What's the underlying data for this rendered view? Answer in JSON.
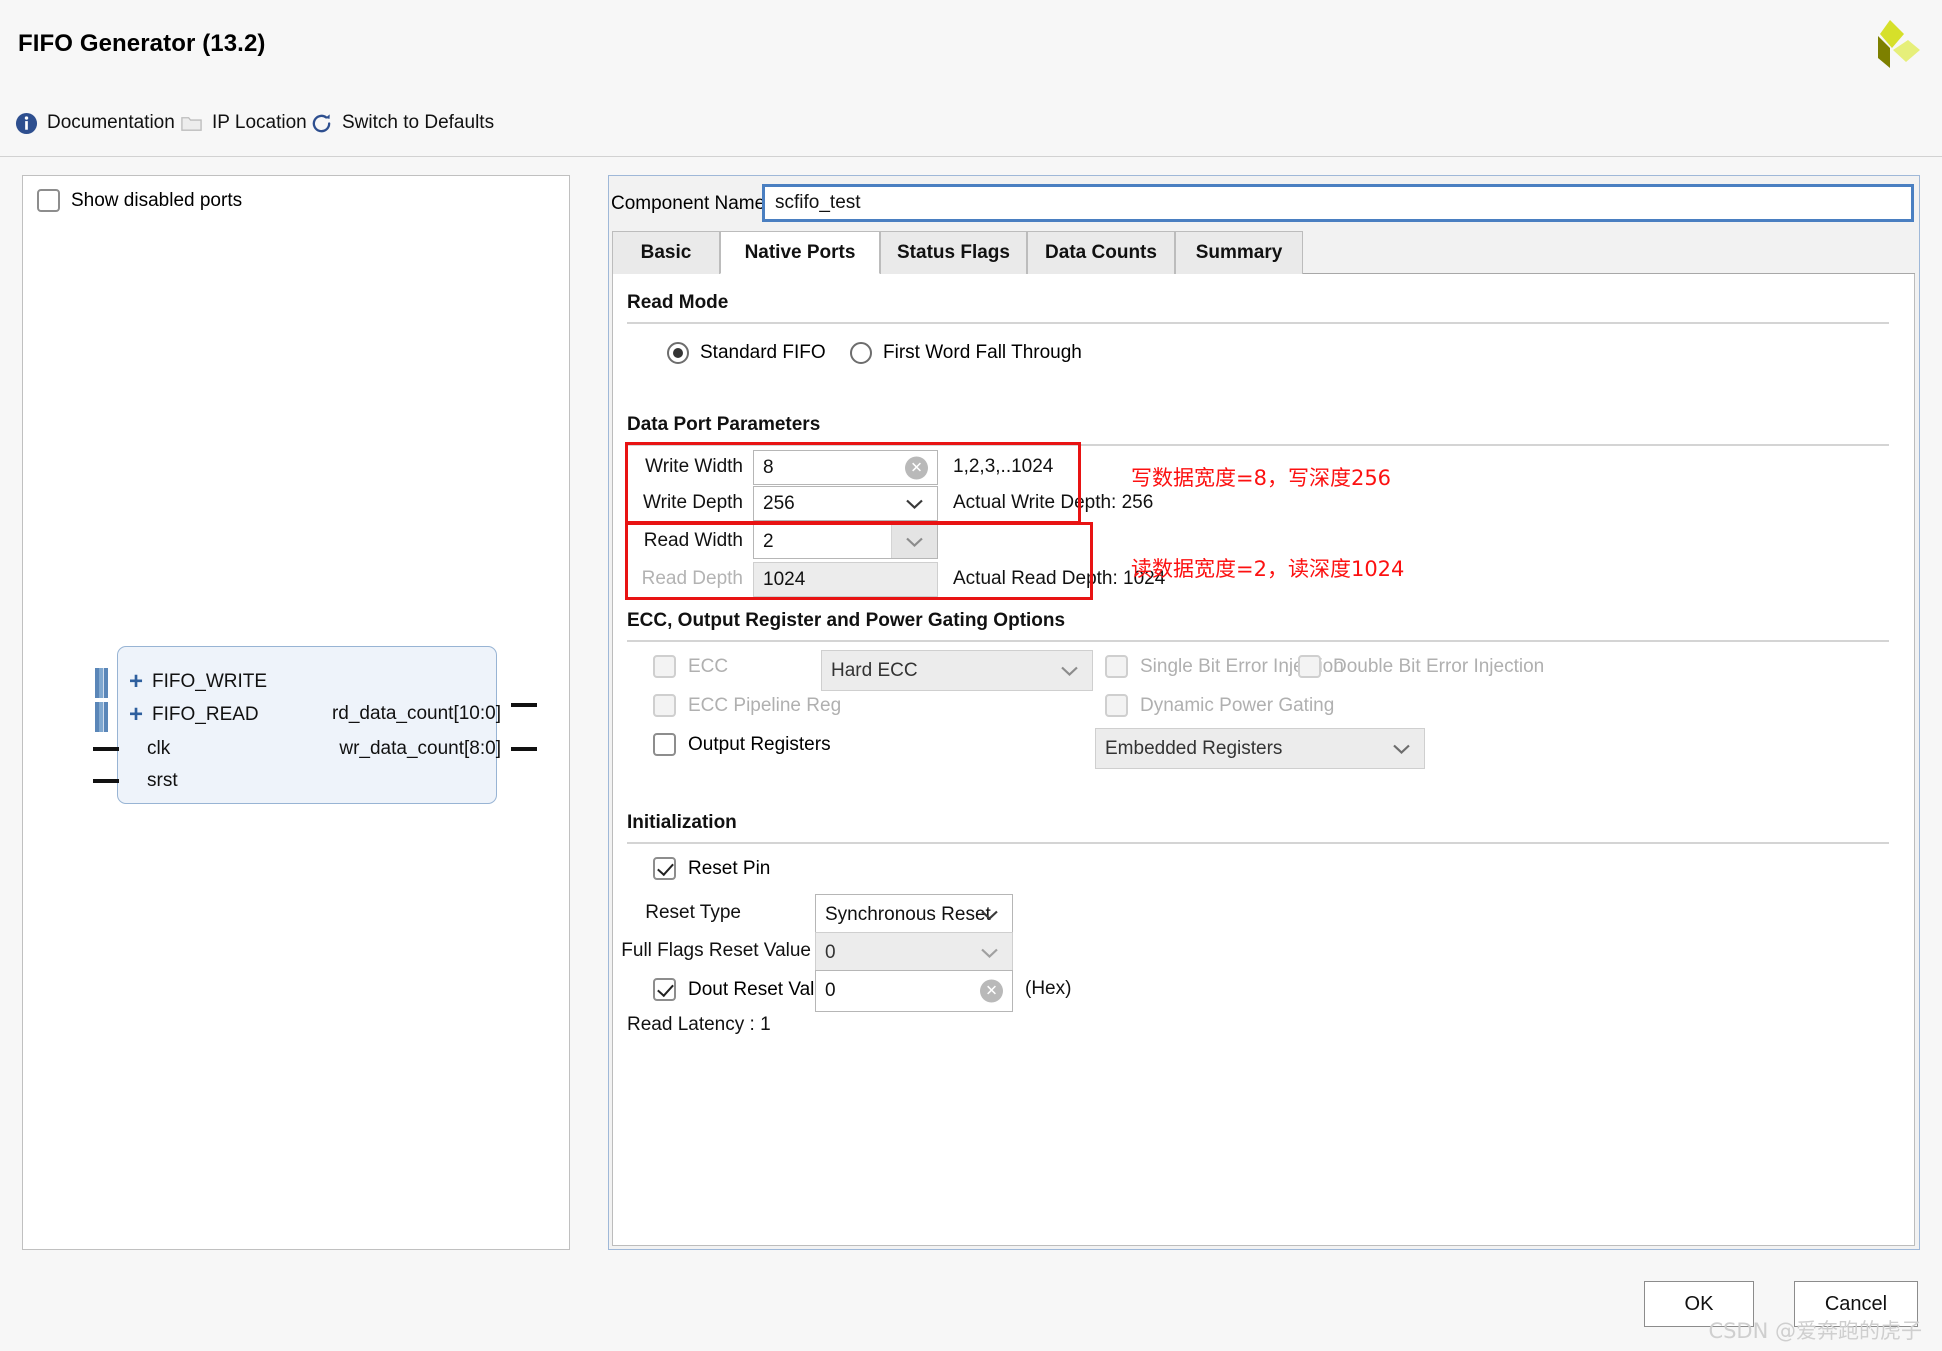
{
  "window": {
    "title": "FIFO Generator (13.2)",
    "logo_colors": [
      "#d6e02a",
      "#7d8000",
      "#e6ef7a"
    ]
  },
  "toolbar": {
    "items": [
      {
        "label": "Documentation",
        "icon": "info-icon"
      },
      {
        "label": "IP Location",
        "icon": "folder-icon"
      },
      {
        "label": "Switch to Defaults",
        "icon": "refresh-icon"
      }
    ]
  },
  "left_panel": {
    "show_disabled_ports": {
      "label": "Show disabled ports",
      "checked": false
    },
    "symbol": {
      "inputs_bus": [
        "FIFO_WRITE",
        "FIFO_READ"
      ],
      "inputs_pin": [
        "clk",
        "srst"
      ],
      "outputs": [
        "rd_data_count[10:0]",
        "wr_data_count[8:0]"
      ]
    }
  },
  "component_name": {
    "label": "Component Name",
    "value": "scfifo_test",
    "placeholder": "Component Name"
  },
  "tabs": [
    {
      "label": "Basic",
      "active": false
    },
    {
      "label": "Native Ports",
      "active": true
    },
    {
      "label": "Status Flags",
      "active": false
    },
    {
      "label": "Data Counts",
      "active": false
    },
    {
      "label": "Summary",
      "active": false
    }
  ],
  "read_mode": {
    "section_title": "Read Mode",
    "options": [
      {
        "label": "Standard FIFO",
        "selected": true
      },
      {
        "label": "First Word Fall Through",
        "selected": false
      }
    ]
  },
  "data_port_parameters": {
    "section_title": "Data Port Parameters",
    "write_width": {
      "label": "Write Width",
      "value": "8",
      "hint": "1,2,3,..1024"
    },
    "write_depth": {
      "label": "Write Depth",
      "value": "256",
      "hint": "Actual Write Depth: 256"
    },
    "read_width": {
      "label": "Read Width",
      "value": "2",
      "hint": ""
    },
    "read_depth": {
      "label": "Read Depth",
      "value": "1024",
      "hint": "Actual Read Depth: 1024",
      "disabled": true
    }
  },
  "annotations": {
    "accent_color": "#fc1111",
    "write_note": "写数据宽度=8，写深度256",
    "read_note": "读数据宽度=2，读深度1024"
  },
  "ecc_section": {
    "section_title": "ECC, Output Register and Power Gating Options",
    "ecc": {
      "label": "ECC",
      "checked": false,
      "disabled": true
    },
    "ecc_mode": {
      "value": "Hard ECC",
      "disabled": true
    },
    "single_bit": {
      "label": "Single Bit Error Injection",
      "checked": false,
      "disabled": true
    },
    "double_bit": {
      "label": "Double Bit Error Injection",
      "checked": false,
      "disabled": true
    },
    "ecc_pipeline": {
      "label": "ECC Pipeline Reg",
      "checked": false,
      "disabled": true
    },
    "dynamic_power": {
      "label": "Dynamic Power Gating",
      "checked": false,
      "disabled": true
    },
    "output_registers": {
      "label": "Output Registers",
      "checked": false,
      "disabled": false
    },
    "register_type": {
      "value": "Embedded Registers",
      "disabled": true
    }
  },
  "initialization": {
    "section_title": "Initialization",
    "reset_pin": {
      "label": "Reset Pin",
      "checked": true
    },
    "reset_type": {
      "label": "Reset Type",
      "value": "Synchronous Reset"
    },
    "full_flags_reset": {
      "label": "Full Flags Reset Value",
      "value": "0",
      "disabled": true
    },
    "dout_reset": {
      "label": "Dout Reset Value",
      "value": "0",
      "checked": true,
      "suffix": "(Hex)"
    },
    "read_latency": "Read Latency : 1"
  },
  "footer": {
    "ok": "OK",
    "cancel": "Cancel"
  },
  "watermark": "CSDN @爱奔跑的虎子"
}
